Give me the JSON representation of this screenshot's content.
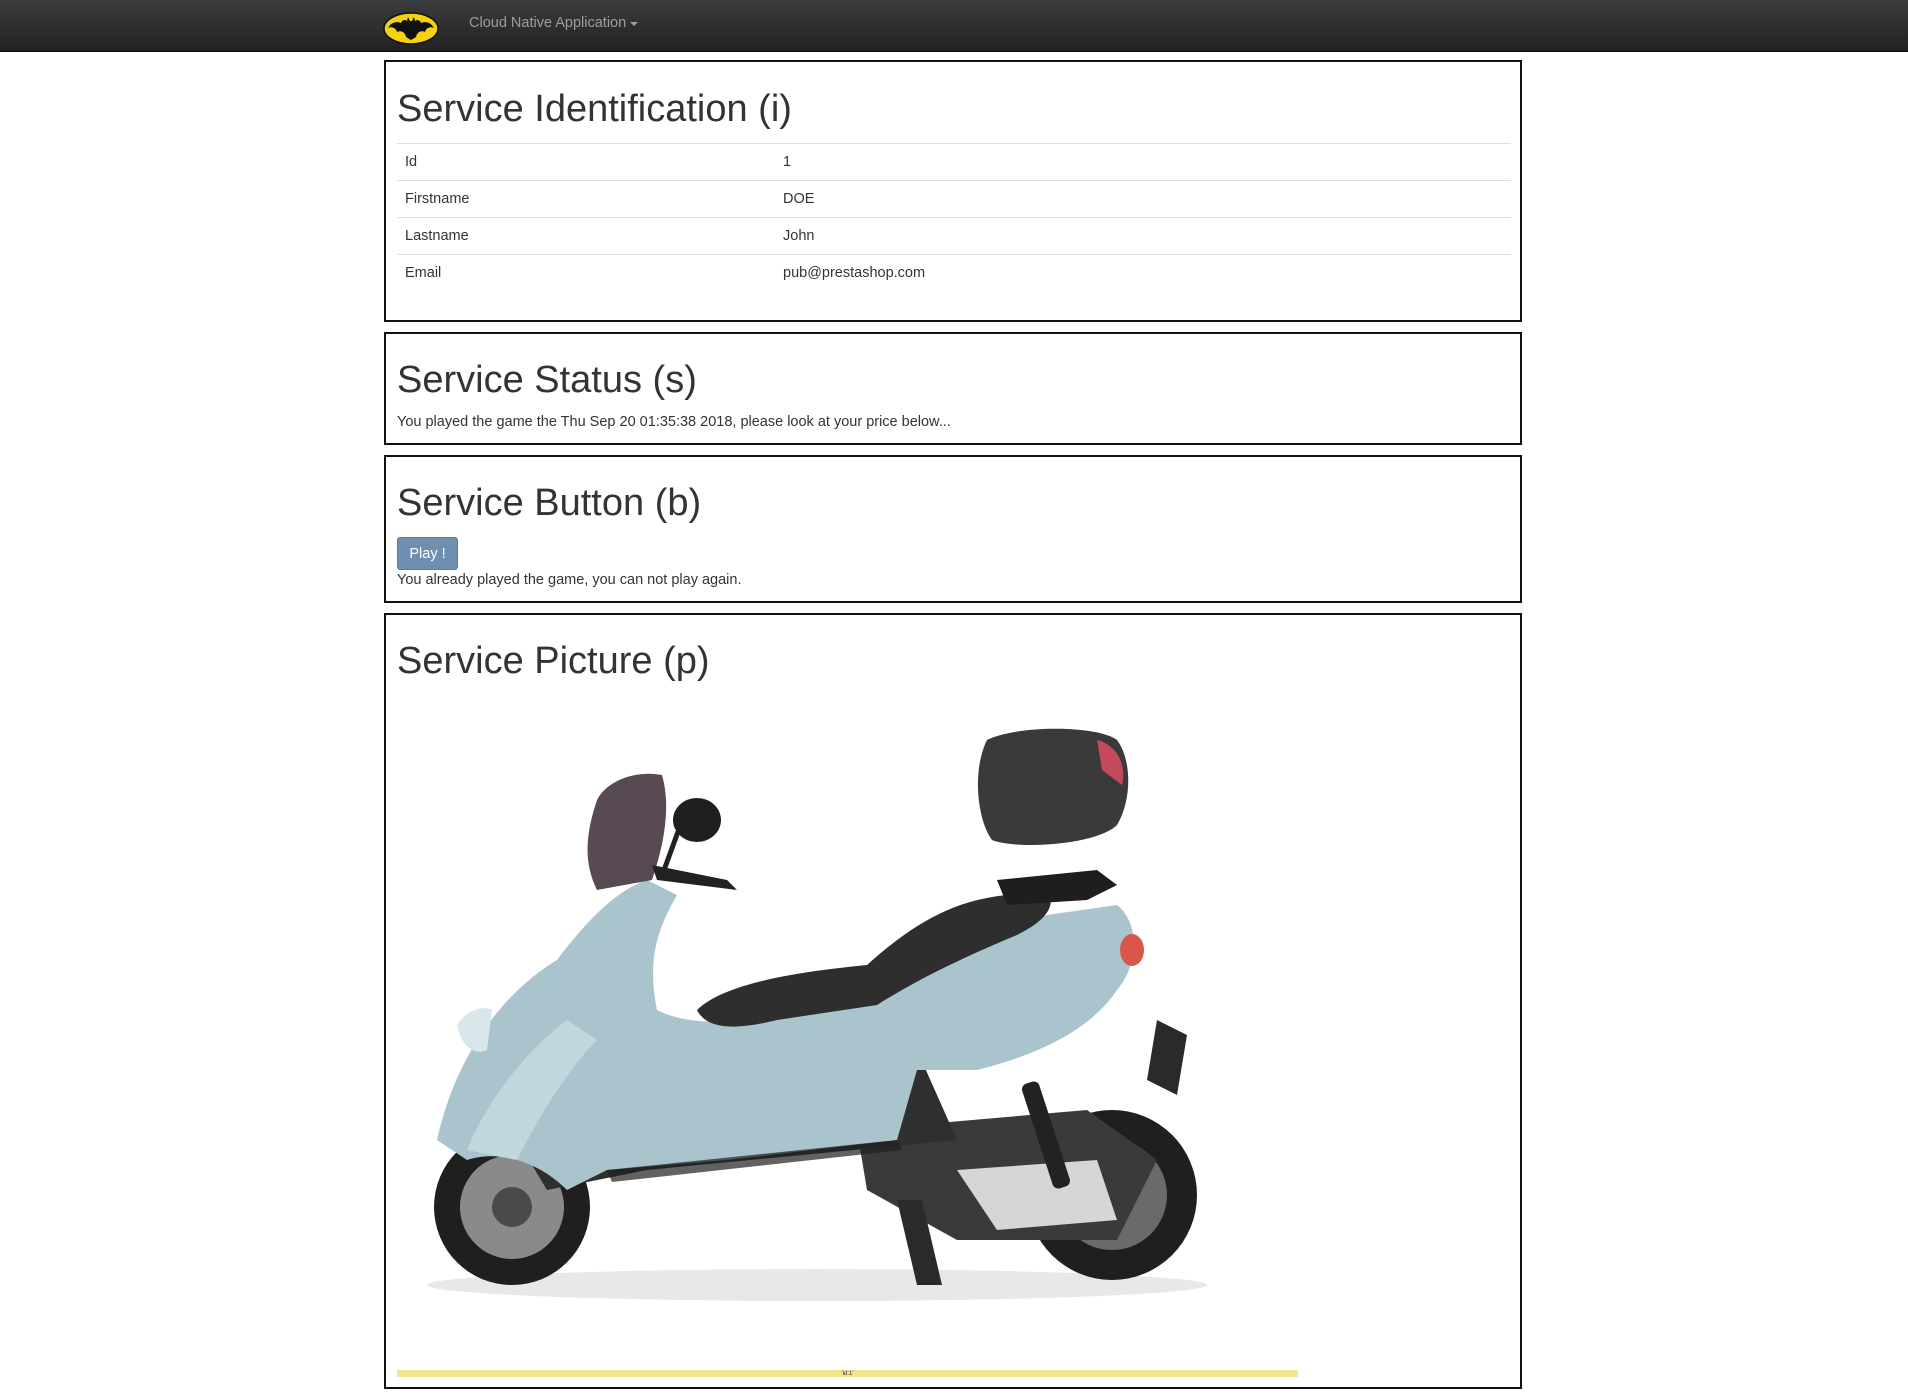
{
  "navbar": {
    "logo_icon": "batman-logo-icon",
    "menu_label": "Cloud Native Application"
  },
  "identification": {
    "title": "Service Identification (i)",
    "rows": [
      {
        "key": "Id",
        "value": "1"
      },
      {
        "key": "Firstname",
        "value": "DOE"
      },
      {
        "key": "Lastname",
        "value": "John"
      },
      {
        "key": "Email",
        "value": "pub@prestashop.com"
      }
    ]
  },
  "status": {
    "title": "Service Status (s)",
    "message": "You played the game the Thu Sep 20 01:35:38 2018, please look at your price below..."
  },
  "button": {
    "title": "Service Button (b)",
    "play_label": "Play !",
    "message": "You already played the game, you can not play again."
  },
  "picture": {
    "title": "Service Picture (p)",
    "image_icon": "scooter-image",
    "bar_label": "'id:1'"
  },
  "colors": {
    "navbar": "#222222",
    "button": "#6f8fb1",
    "price_bar": "#f0e68c"
  }
}
